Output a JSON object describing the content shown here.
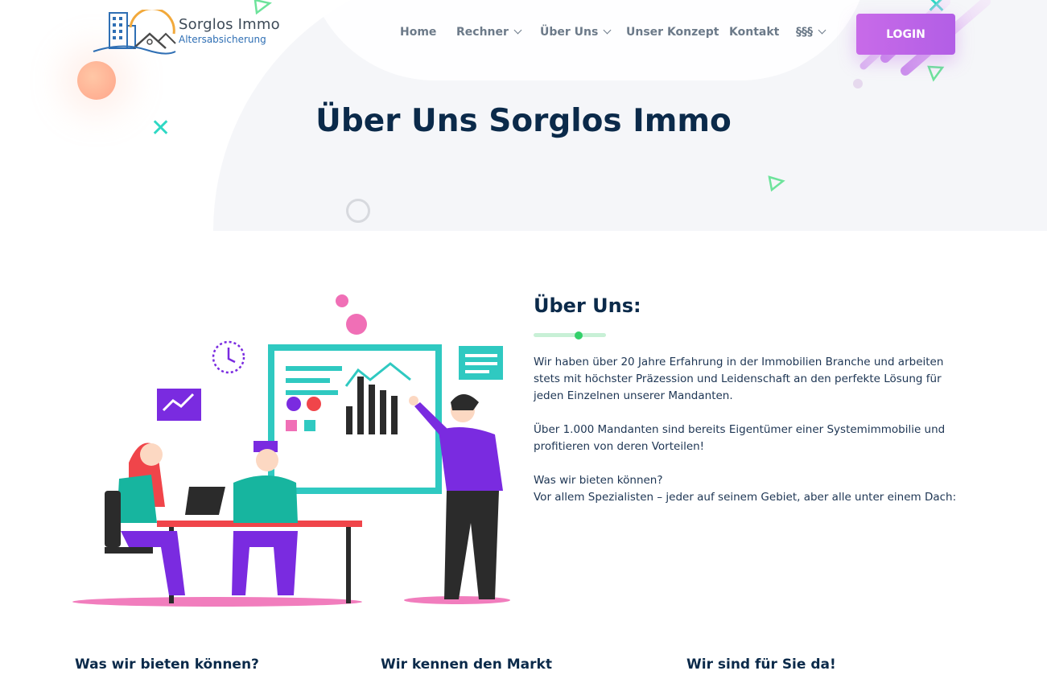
{
  "brand": {
    "name": "Sorglos Immo",
    "tagline": "Altersabsicherung"
  },
  "nav": {
    "items": [
      {
        "label": "Home",
        "dropdown": false
      },
      {
        "label": "Rechner",
        "dropdown": true
      },
      {
        "label": "Über Uns",
        "dropdown": true
      },
      {
        "label": "Unser Konzept",
        "dropdown": false
      },
      {
        "label": "Kontakt",
        "dropdown": false
      },
      {
        "label": "§§§",
        "dropdown": true
      }
    ],
    "login_label": "LOGIN"
  },
  "hero": {
    "title": "Über Uns Sorglos Immo"
  },
  "about": {
    "heading": "Über Uns:",
    "paragraphs": [
      "Wir haben über 20 Jahre Erfahrung in der Immobilien Branche und arbeiten stets mit höchster Präzession und Leidenschaft an den perfekte Lösung für jeden Einzelnen unserer Mandanten.",
      "Über 1.000 Mandanten sind bereits Eigentümer einer Systemimmobilie und profitieren von deren Vorteilen!",
      "Was wir bieten können?",
      "Vor allem Spezialisten – jeder auf seinem Gebiet, aber alle unter einem Dach:"
    ]
  },
  "columns": [
    {
      "title": "Was wir bieten können?"
    },
    {
      "title": "Wir kennen den Markt"
    },
    {
      "title": "Wir sind für Sie da!"
    }
  ],
  "colors": {
    "primary_text": "#0b2a4a",
    "nav_text": "#6c7a89",
    "login_bg": "#b25ee6",
    "accent_green": "#33d06a",
    "accent_teal": "#2fd8c4"
  }
}
